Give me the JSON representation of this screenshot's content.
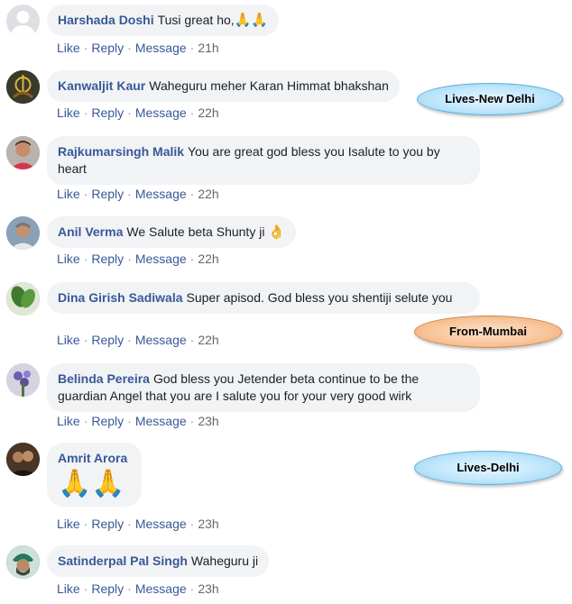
{
  "actions": {
    "like": "Like",
    "reply": "Reply",
    "message": "Message"
  },
  "comments": [
    {
      "author": "Harshada Doshi",
      "text": "Tusi great ho,",
      "emoji": "🙏🙏",
      "time": "21h",
      "avatar": "default-avatar-icon"
    },
    {
      "author": "Kanwaljit Kaur",
      "text": "Waheguru meher Karan Himmat bhakshan",
      "time": "22h",
      "avatar": "khanda-avatar"
    },
    {
      "author": "Rajkumarsingh Malik",
      "text": "You are great god bless you Isalute to you by heart",
      "time": "22h",
      "avatar": "man-avatar"
    },
    {
      "author": "Anil Verma",
      "text": "We Salute beta Shunty ji",
      "emoji": "👌",
      "time": "22h",
      "avatar": "man-avatar"
    },
    {
      "author": "Dina Girish Sadiwala",
      "text": "Super apisod. God bless you shentiji selute you",
      "time": "22h",
      "avatar": "plant-avatar"
    },
    {
      "author": "Belinda Pereira",
      "text": "God bless you Jetender beta continue to be the guardian Angel that you are I salute you for your very good wirk",
      "time": "23h",
      "avatar": "flowers-avatar"
    },
    {
      "author": "Amrit Arora",
      "text": "",
      "emoji": "🙏🙏",
      "time": "23h",
      "avatar": "couple-avatar"
    },
    {
      "author": "Satinderpal Pal Singh",
      "text": "Waheguru ji",
      "time": "23h",
      "avatar": "turban-avatar"
    }
  ],
  "tags": [
    {
      "label": "Lives-New Delhi",
      "color": "blue"
    },
    {
      "label": "From-Mumbai",
      "color": "orange"
    },
    {
      "label": "Lives-Delhi",
      "color": "blue"
    }
  ]
}
